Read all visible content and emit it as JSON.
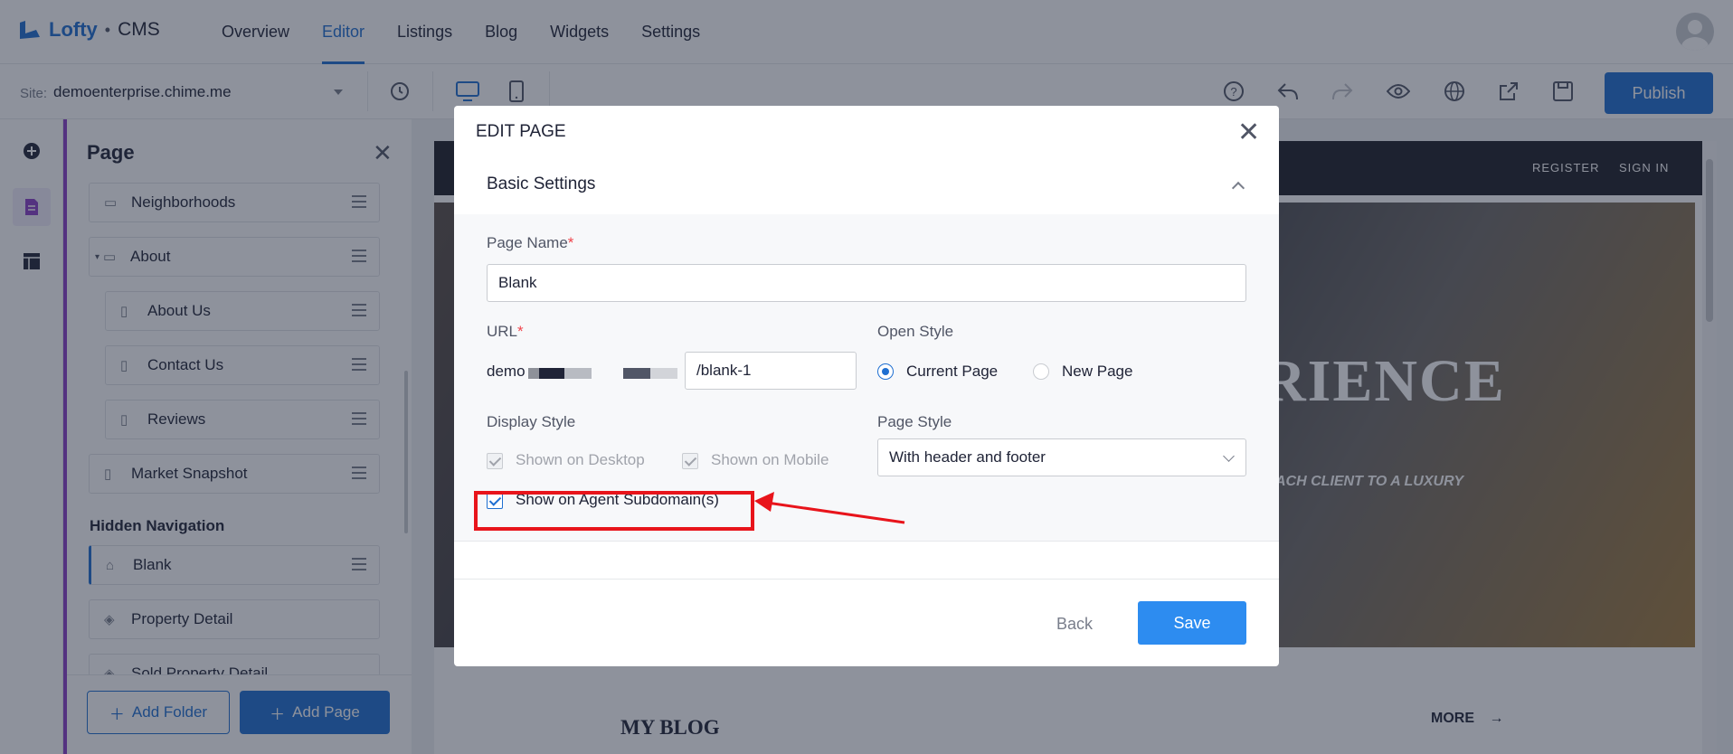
{
  "header": {
    "brand": "Lofty",
    "separator": "•",
    "product": "CMS",
    "nav": [
      "Overview",
      "Editor",
      "Listings",
      "Blog",
      "Widgets",
      "Settings"
    ],
    "active_nav": "Editor"
  },
  "toolbar": {
    "site_label": "Site:",
    "site_value": "demoenterprise.chime.me",
    "publish_label": "Publish",
    "icons": [
      "history-icon",
      "desktop-icon",
      "mobile-icon",
      "help-icon",
      "undo-icon",
      "redo-icon",
      "preview-icon",
      "globe-icon",
      "share-icon",
      "save-icon"
    ]
  },
  "rail": {
    "icons": [
      "add-icon",
      "page-icon",
      "layout-icon"
    ]
  },
  "panel": {
    "title": "Page",
    "items": [
      {
        "label": "Neighborhoods",
        "icon": "folder-icon"
      },
      {
        "label": "About",
        "icon": "folder-icon"
      },
      {
        "label": "About Us",
        "icon": "page-icon"
      },
      {
        "label": "Contact Us",
        "icon": "page-icon"
      },
      {
        "label": "Reviews",
        "icon": "page-icon"
      },
      {
        "label": "Market Snapshot",
        "icon": "page-icon"
      }
    ],
    "hidden_nav_label": "Hidden Navigation",
    "hidden_items": [
      {
        "label": "Blank",
        "icon": "lock-page-icon"
      },
      {
        "label": "Property Detail",
        "icon": "layers-icon"
      },
      {
        "label": "Sold Property Detail",
        "icon": "layers-icon"
      }
    ],
    "add_folder_label": "Add Folder",
    "add_page_label": "Add Page"
  },
  "preview": {
    "register": "REGISTER",
    "sign_in": "SIGN IN",
    "hero_title": "RIENCE",
    "hero_subtitle": "ACH CLIENT TO A LUXURY",
    "blog_title": "MY BLOG",
    "more_label": "MORE"
  },
  "modal": {
    "title": "EDIT PAGE",
    "section_title": "Basic Settings",
    "page_name_label": "Page Name",
    "page_name_value": "Blank",
    "url_label": "URL",
    "url_prefix": "demo",
    "url_value": "/blank-1",
    "open_style_label": "Open Style",
    "open_style_options": [
      "Current Page",
      "New Page"
    ],
    "open_style_selected": "Current Page",
    "display_style_label": "Display Style",
    "shown_on_desktop": "Shown on Desktop",
    "shown_on_mobile": "Shown on Mobile",
    "show_on_agent": "Show on Agent Subdomain(s)",
    "page_style_label": "Page Style",
    "page_style_value": "With header and footer",
    "back_label": "Back",
    "save_label": "Save"
  },
  "colors": {
    "accent": "#1f6fd1",
    "save": "#2d8cf0",
    "annotation": "#e8141b",
    "panel_accent": "#8a3ec7"
  }
}
